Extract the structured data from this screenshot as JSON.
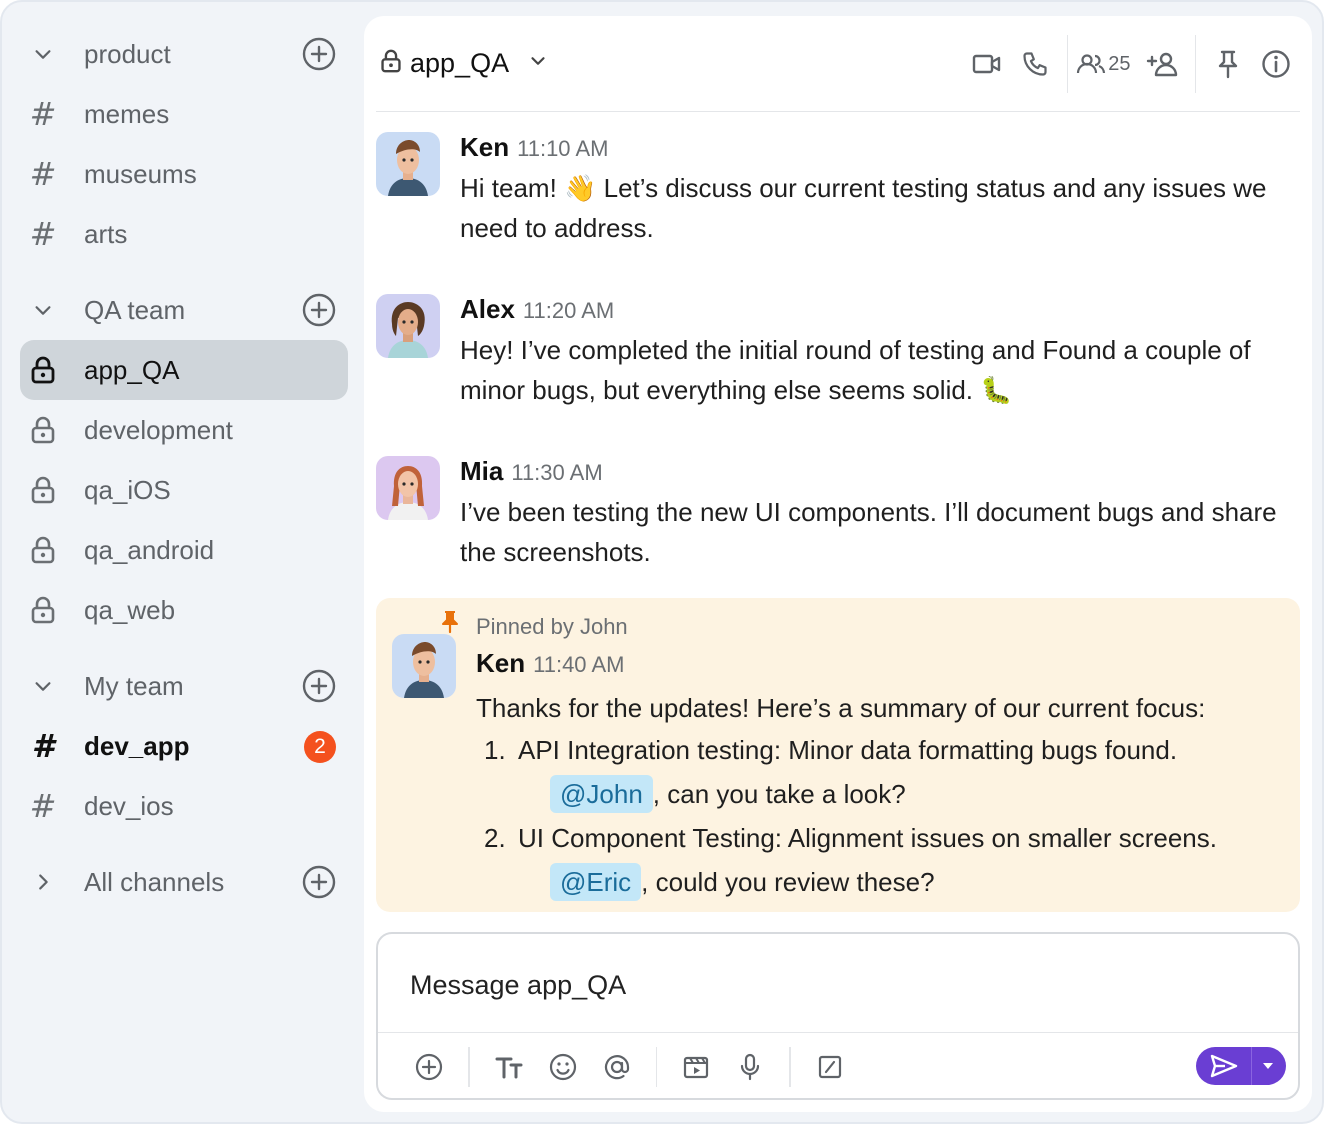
{
  "sidebar": {
    "groups": [
      {
        "label": "product",
        "expanded": true
      },
      {
        "label": "QA team",
        "expanded": true
      },
      {
        "label": "My team",
        "expanded": true
      },
      {
        "label": "All channels",
        "expanded": false
      }
    ],
    "product_channels": [
      "memes",
      "museums",
      "arts"
    ],
    "qa_channels": [
      "app_QA",
      "development",
      "qa_iOS",
      "qa_android",
      "qa_web"
    ],
    "myteam_channels": [
      {
        "label": "dev_app",
        "badge": "2",
        "unread": true
      },
      {
        "label": "dev_ios"
      }
    ],
    "active_channel": "app_QA",
    "badge_color": "#f4511e"
  },
  "header": {
    "channel_name": "app_QA",
    "member_count": "25",
    "icons": [
      "lock-icon",
      "chevron-down-icon",
      "video-icon",
      "phone-icon",
      "members-icon",
      "add-member-icon",
      "pin-icon",
      "info-icon"
    ]
  },
  "messages": [
    {
      "author": "Ken",
      "time": "11:10 AM",
      "text": "Hi team! 👋 Let’s discuss our current testing status and any issues we need to address."
    },
    {
      "author": "Alex",
      "time": "11:20 AM",
      "text": "Hey! I’ve completed the initial round of testing and Found a couple of minor bugs, but everything else seems solid. 🐛"
    },
    {
      "author": "Mia",
      "time": "11:30 AM",
      "text": "I’ve been testing the new UI components. I’ll document bugs and share the screenshots."
    }
  ],
  "pinned": {
    "label": "Pinned by John",
    "author": "Ken",
    "time": "11:40 AM",
    "intro": "Thanks for the updates! Here’s a summary of our current focus:",
    "items": [
      {
        "num": "1.",
        "text": "API Integration testing: Minor data formatting bugs found.",
        "mention": "@John",
        "followup": ", can you take a look?"
      },
      {
        "num": "2.",
        "text": "UI Component Testing: Alignment issues on smaller screens.",
        "mention": "@Eric",
        "followup": ", could you review these?"
      }
    ],
    "bg_color": "#fdf3e1"
  },
  "composer": {
    "placeholder": "Message app_QA",
    "send_color": "#6a3ed3"
  }
}
